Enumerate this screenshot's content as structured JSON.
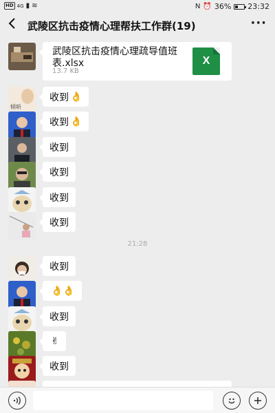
{
  "status_bar": {
    "network": "HD",
    "signal": "4G",
    "alarm": "⏰",
    "battery": "36%",
    "battery_level": 0.36,
    "time": "23:32"
  },
  "header": {
    "title": "武陵区抗击疫情心理帮扶工作群(19)",
    "back_icon": "back-chevron-icon",
    "more_icon": "more-dots-icon"
  },
  "file_message": {
    "name": "武陵区抗击疫情心理疏导值班表.xlsx",
    "size": "13.7 KB",
    "icon": "excel-file-icon",
    "icon_letter": "X"
  },
  "messages_before": [
    {
      "text": "收到",
      "emoji": "👌"
    },
    {
      "text": "收到",
      "emoji": "👌"
    },
    {
      "text": "收到",
      "emoji": ""
    },
    {
      "text": "收到",
      "emoji": ""
    },
    {
      "text": "收到",
      "emoji": ""
    },
    {
      "text": "收到",
      "emoji": ""
    }
  ],
  "timestamp": "21:28",
  "messages_after": [
    {
      "text": "收到",
      "emoji": ""
    },
    {
      "text": "",
      "emoji": "👌👌"
    },
    {
      "text": "收到",
      "emoji": ""
    },
    {
      "text": "",
      "emoji": "✌"
    },
    {
      "text": "收到",
      "emoji": ""
    }
  ],
  "input_bar": {
    "voice_icon": "voice-icon",
    "emoji_icon": "emoji-icon",
    "plus_icon": "plus-icon",
    "placeholder": ""
  },
  "colors": {
    "background": "#ededed",
    "bubble": "#ffffff",
    "excel_green": "#1f8f45"
  }
}
